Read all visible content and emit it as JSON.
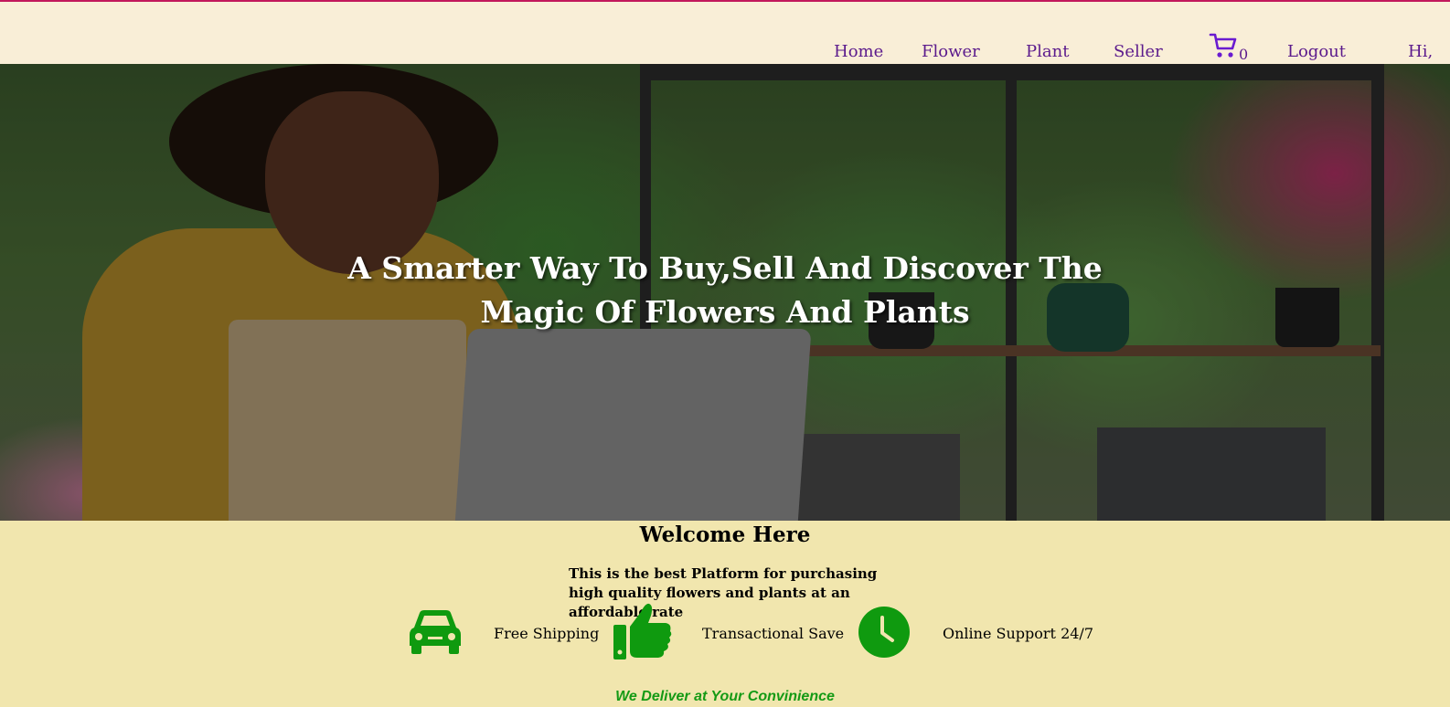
{
  "nav": {
    "items": [
      {
        "label": "Home"
      },
      {
        "label": "Flower"
      },
      {
        "label": "Plant"
      },
      {
        "label": "Seller"
      }
    ],
    "cart_icon": "shopping-cart-icon",
    "cart_count": "0",
    "logout": "Logout",
    "greeting": "Hi,",
    "link_color": "#5b1a8c",
    "cart_color": "#6a1bd0"
  },
  "hero": {
    "title_line1": "A Smarter Way To Buy,Sell And Discover The",
    "title_line2": "Magic Of Flowers And Plants"
  },
  "welcome": {
    "title": "Welcome Here",
    "subtitle": "This is the best Platform for purchasing high quality flowers and plants at an affordable rate"
  },
  "features": [
    {
      "icon": "car-icon",
      "label": "Free Shipping"
    },
    {
      "icon": "thumbs-up-icon",
      "label": "Transactional Save"
    },
    {
      "icon": "clock-icon",
      "label": "Online Support 24/7"
    }
  ],
  "tagline": "We Deliver at Your Convinience",
  "colors": {
    "header_bg": "#f9eed7",
    "section_bg": "#f1e6ae",
    "icon_green": "#0f9a0f",
    "accent_line": "#c2185b"
  }
}
